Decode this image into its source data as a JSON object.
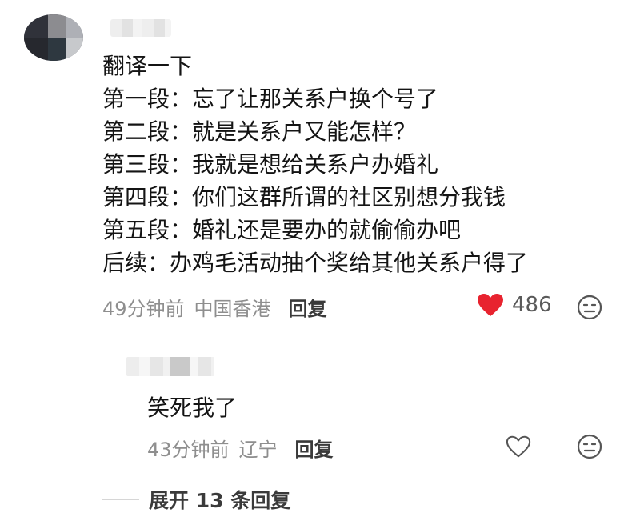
{
  "comment": {
    "lines": [
      "翻译一下",
      "第一段：忘了让那关系户换个号了",
      "第二段：就是关系户又能怎样？",
      "第三段：我就是想给关系户办婚礼",
      "第四段：你们这群所谓的社区别想分我钱",
      "第五段：婚礼还是要办的就偷偷办吧",
      "后续：办鸡毛活动抽个奖给其他关系户得了"
    ],
    "time": "49分钟前",
    "location": "中国香港",
    "reply_label": "回复",
    "like_count": "486",
    "like_color": "#e8232f"
  },
  "reply": {
    "text": "笑死我了",
    "time": "43分钟前",
    "location": "辽宁",
    "reply_label": "回复"
  },
  "expand_label": "展开 13 条回复"
}
